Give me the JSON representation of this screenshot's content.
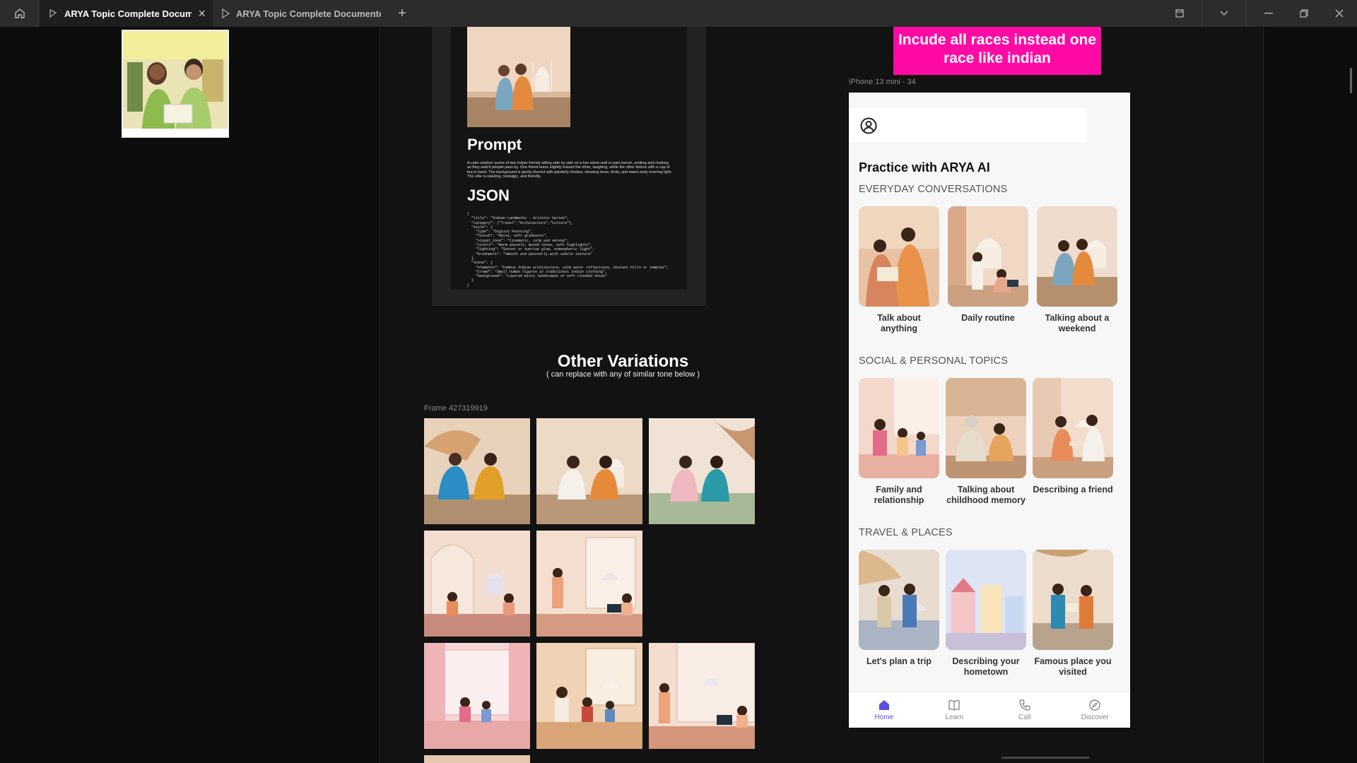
{
  "tabs": [
    {
      "label": "ARYA Topic Complete Document",
      "active": true
    },
    {
      "label": "ARYA Topic Complete Documented Fi",
      "active": false
    }
  ],
  "doc": {
    "prompt_heading": "Prompt",
    "prompt_text": "A calm outdoor scene of two Indian friends sitting side by side on a low stone wall or park bench, smiling and chatting as they watch people pass by. One friend leans slightly toward the other, laughing, while the other listens with a cup of tea in hand. The background is gently blurred with painterly strokes, showing trees, birds, and warm early evening light. The vibe is relaxing, nostalgic, and friendly.",
    "json_heading": "JSON",
    "json_text": "{\n  \"title\": \"Indian Landmarks - Artistic Series\",\n  \"category\": [\"Travel\",\"Architecture\",\"Culture\"],\n  \"style\": {\n    \"type\": \"Digital Painting\",\n    \"finish\": \"Matte, soft gradients\",\n    \"visual_tone\": \"Cinematic, calm and serene\",\n    \"colors\": \"Warm pastels, muted tones, soft highlights\",\n    \"lighting\": \"Sunset or sunrise glow, atmospheric light\",\n    \"brushwork\": \"Smooth and painterly with subtle texture\"\n  },\n  \"scene\": {\n    \"elements\": \"Famous Indian architecture, calm water reflections, distant hills or temples\",\n    \"crowd\": \"Small human figures in traditional Indian clothing\",\n    \"background\": \"Layered misty landscapes or soft clouded skies\"\n  }\n}"
  },
  "variations": {
    "title": "Other Variations",
    "subtitle": "( can replace with any of similar tone below )",
    "frame_label": "Frame 427319919"
  },
  "annotation": "Incude all races instead one race like indian",
  "phone": {
    "frame_label": "iPhone 13 mini - 34",
    "title": "Practice with ARYA AI",
    "sections": [
      {
        "heading": "EVERYDAY CONVERSATIONS",
        "cards": [
          "Talk about anything",
          "Daily routine",
          "Talking about a weekend"
        ]
      },
      {
        "heading": "SOCIAL & PERSONAL TOPICS",
        "cards": [
          "Family and relationship",
          "Talking about childhood memory",
          "Describing a friend"
        ]
      },
      {
        "heading": "TRAVEL & PLACES",
        "cards": [
          "Let's plan a trip",
          "Describing your hometown",
          "Famous place you visited"
        ]
      }
    ],
    "nav": [
      {
        "label": "Home",
        "icon": "home-icon",
        "active": true
      },
      {
        "label": "Learn",
        "icon": "book-icon",
        "active": false
      },
      {
        "label": "Call",
        "icon": "phone-icon",
        "active": false
      },
      {
        "label": "Discover",
        "icon": "compass-icon",
        "active": false
      }
    ]
  },
  "colors": {
    "annotation_bg": "#ff0aa5",
    "nav_active": "#5b4fe0",
    "titlebar": "#2c2c2c"
  }
}
